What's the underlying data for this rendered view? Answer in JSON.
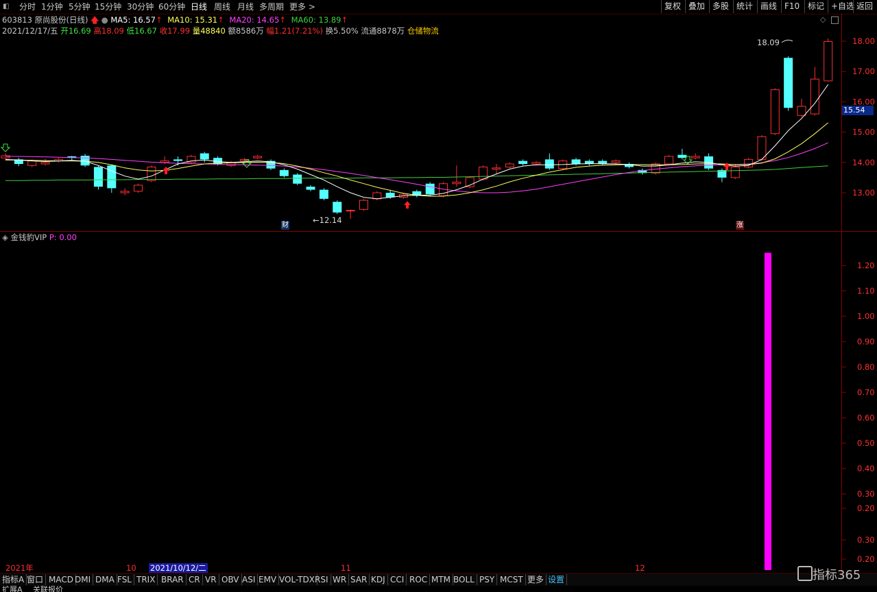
{
  "toolbar": {
    "periods": [
      "分时",
      "1分钟",
      "5分钟",
      "15分钟",
      "30分钟",
      "60分钟",
      "日线",
      "周线",
      "月线",
      "多周期",
      "更多 >"
    ],
    "active_period": "日线",
    "right_buttons": [
      "复权",
      "叠加",
      "多股",
      "统计",
      "画线",
      "F10",
      "标记",
      "+自选",
      "返回"
    ]
  },
  "quote": {
    "stock": "603813 原尚股份(日线)",
    "ma5": "MA5: 16.57",
    "ma10": "MA10: 15.31",
    "ma20": "MA20: 14.65",
    "ma60": "MA60: 13.89",
    "date": "2021/12/17/五",
    "open_label": "开",
    "open": "16.69",
    "high_label": "高",
    "high": "18.09",
    "low_label": "低",
    "low": "16.67",
    "close_label": "收",
    "close": "17.99",
    "vol_label": "量",
    "vol": "48840",
    "amt_label": "额",
    "amt": "8586万",
    "chg_label": "幅",
    "chg": "1.21(7.21%)",
    "turnover": "换5.50%",
    "float": "流通8878万",
    "sector": "仓储物流"
  },
  "annotations": {
    "high_mark": "18.09",
    "low_mark": "←12.14",
    "cai_badge": "财",
    "zhang_badge": "涨",
    "current_price": "15.54"
  },
  "indicator": {
    "name": "金钱豹VIP",
    "value": "P: 0.00"
  },
  "x_labels": {
    "year": "2021年",
    "oct": "10",
    "cursor_date": "2021/10/12/二",
    "nov": "11",
    "dec": "12"
  },
  "bottom_tabs": [
    "指标A",
    "窗口",
    "MACD",
    "DMI",
    "DMA",
    "FSL",
    "TRIX",
    "BRAR",
    "CR",
    "VR",
    "OBV",
    "ASI",
    "EMV",
    "VOL-TDX",
    "RSI",
    "WR",
    "SAR",
    "KDJ",
    "CCI",
    "ROC",
    "MTM",
    "BOLL",
    "PSY",
    "MCST",
    "更多",
    "设置"
  ],
  "status_tabs": [
    "扩展A",
    "关联报价"
  ],
  "logo": "指标365",
  "colors": {
    "up": "#ff3030",
    "down": "#54ffff",
    "ma5": "#ffffff",
    "ma10": "#ffff60",
    "ma20": "#ff40ff",
    "ma60": "#40d040",
    "indicator_bar": "#ff00ff",
    "frame": "#8a0000"
  },
  "chart_data": [
    {
      "type": "candlestick",
      "title": "603813 原尚股份(日线)",
      "y_ticks": [
        13.0,
        14.0,
        15.0,
        16.0,
        17.0,
        18.0
      ],
      "ylim": [
        12.0,
        18.3
      ],
      "x_labels": [
        "2021年",
        "10",
        "11",
        "12"
      ],
      "candles": [
        {
          "o": 14.15,
          "c": 14.22,
          "h": 14.3,
          "l": 14.1
        },
        {
          "o": 14.1,
          "c": 13.95,
          "h": 14.15,
          "l": 13.88
        },
        {
          "o": 13.9,
          "c": 14.05,
          "h": 14.1,
          "l": 13.85
        },
        {
          "o": 13.95,
          "c": 14.0,
          "h": 14.12,
          "l": 13.9
        },
        {
          "o": 14.05,
          "c": 14.1,
          "h": 14.15,
          "l": 14.0
        },
        {
          "o": 14.2,
          "c": 14.15,
          "h": 14.22,
          "l": 14.08
        },
        {
          "o": 14.22,
          "c": 13.9,
          "h": 14.28,
          "l": 13.85
        },
        {
          "o": 13.85,
          "c": 13.2,
          "h": 13.9,
          "l": 13.1
        },
        {
          "o": 13.9,
          "c": 13.15,
          "h": 13.92,
          "l": 13.0
        },
        {
          "o": 13.0,
          "c": 13.05,
          "h": 13.15,
          "l": 12.92
        },
        {
          "o": 13.05,
          "c": 13.25,
          "h": 13.3,
          "l": 13.0
        },
        {
          "o": 13.4,
          "c": 13.85,
          "h": 13.9,
          "l": 13.35
        },
        {
          "o": 14.0,
          "c": 14.05,
          "h": 14.2,
          "l": 13.95
        },
        {
          "o": 14.1,
          "c": 14.05,
          "h": 14.2,
          "l": 13.9
        },
        {
          "o": 14.0,
          "c": 14.2,
          "h": 14.25,
          "l": 13.95
        },
        {
          "o": 14.3,
          "c": 14.1,
          "h": 14.35,
          "l": 14.0
        },
        {
          "o": 14.15,
          "c": 13.95,
          "h": 14.2,
          "l": 13.9
        },
        {
          "o": 13.9,
          "c": 14.0,
          "h": 14.05,
          "l": 13.85
        },
        {
          "o": 14.05,
          "c": 14.1,
          "h": 14.15,
          "l": 14.0
        },
        {
          "o": 14.15,
          "c": 14.2,
          "h": 14.25,
          "l": 14.1
        },
        {
          "o": 14.05,
          "c": 13.8,
          "h": 14.1,
          "l": 13.75
        },
        {
          "o": 13.75,
          "c": 13.55,
          "h": 13.8,
          "l": 13.5
        },
        {
          "o": 13.6,
          "c": 13.3,
          "h": 13.65,
          "l": 13.25
        },
        {
          "o": 13.2,
          "c": 13.1,
          "h": 13.25,
          "l": 13.05
        },
        {
          "o": 13.1,
          "c": 12.8,
          "h": 13.15,
          "l": 12.75
        },
        {
          "o": 12.7,
          "c": 12.35,
          "h": 12.75,
          "l": 12.3
        },
        {
          "o": 12.4,
          "c": 12.42,
          "h": 12.45,
          "l": 12.14
        },
        {
          "o": 12.45,
          "c": 12.75,
          "h": 12.8,
          "l": 12.4
        },
        {
          "o": 12.8,
          "c": 13.0,
          "h": 13.05,
          "l": 12.75
        },
        {
          "o": 13.0,
          "c": 12.85,
          "h": 13.1,
          "l": 12.8
        },
        {
          "o": 12.85,
          "c": 12.95,
          "h": 13.0,
          "l": 12.8
        },
        {
          "o": 13.05,
          "c": 12.9,
          "h": 13.1,
          "l": 12.85
        },
        {
          "o": 13.3,
          "c": 12.95,
          "h": 13.35,
          "l": 12.9
        },
        {
          "o": 12.9,
          "c": 13.3,
          "h": 13.35,
          "l": 12.85
        },
        {
          "o": 13.3,
          "c": 13.35,
          "h": 13.9,
          "l": 13.2
        },
        {
          "o": 13.2,
          "c": 13.5,
          "h": 13.55,
          "l": 13.15
        },
        {
          "o": 13.45,
          "c": 13.85,
          "h": 13.9,
          "l": 13.4
        },
        {
          "o": 13.78,
          "c": 13.82,
          "h": 13.95,
          "l": 13.6
        },
        {
          "o": 13.85,
          "c": 13.95,
          "h": 14.0,
          "l": 13.8
        },
        {
          "o": 14.05,
          "c": 13.95,
          "h": 14.1,
          "l": 13.9
        },
        {
          "o": 13.95,
          "c": 14.0,
          "h": 14.05,
          "l": 13.9
        },
        {
          "o": 14.1,
          "c": 13.8,
          "h": 14.3,
          "l": 13.75
        },
        {
          "o": 13.8,
          "c": 14.05,
          "h": 14.1,
          "l": 13.75
        },
        {
          "o": 14.1,
          "c": 13.95,
          "h": 14.15,
          "l": 13.9
        },
        {
          "o": 14.05,
          "c": 13.95,
          "h": 14.1,
          "l": 13.9
        },
        {
          "o": 14.05,
          "c": 13.95,
          "h": 14.1,
          "l": 13.9
        },
        {
          "o": 14.0,
          "c": 14.05,
          "h": 14.1,
          "l": 13.95
        },
        {
          "o": 13.95,
          "c": 13.85,
          "h": 14.0,
          "l": 13.8
        },
        {
          "o": 13.75,
          "c": 13.65,
          "h": 13.8,
          "l": 13.6
        },
        {
          "o": 13.65,
          "c": 13.95,
          "h": 14.0,
          "l": 13.6
        },
        {
          "o": 13.95,
          "c": 14.2,
          "h": 14.25,
          "l": 13.9
        },
        {
          "o": 14.25,
          "c": 14.15,
          "h": 14.45,
          "l": 14.1
        },
        {
          "o": 14.15,
          "c": 14.2,
          "h": 14.3,
          "l": 14.1
        },
        {
          "o": 14.2,
          "c": 13.8,
          "h": 14.3,
          "l": 13.75
        },
        {
          "o": 13.75,
          "c": 13.5,
          "h": 13.8,
          "l": 13.35
        },
        {
          "o": 13.5,
          "c": 13.85,
          "h": 13.95,
          "l": 13.45
        },
        {
          "o": 13.85,
          "c": 14.1,
          "h": 14.15,
          "l": 13.8
        },
        {
          "o": 14.1,
          "c": 14.85,
          "h": 14.9,
          "l": 14.05
        },
        {
          "o": 14.95,
          "c": 16.4,
          "h": 16.45,
          "l": 14.9
        },
        {
          "o": 17.45,
          "c": 15.8,
          "h": 17.5,
          "l": 15.7
        },
        {
          "o": 15.55,
          "c": 15.85,
          "h": 16.1,
          "l": 15.5
        },
        {
          "o": 15.6,
          "c": 16.75,
          "h": 17.15,
          "l": 15.55
        },
        {
          "o": 16.69,
          "c": 17.99,
          "h": 18.09,
          "l": 16.67
        }
      ],
      "ma5": [
        14.1,
        14.08,
        14.05,
        14.03,
        14.05,
        14.07,
        14.04,
        13.9,
        13.72,
        13.55,
        13.45,
        13.55,
        13.75,
        13.95,
        14.05,
        14.08,
        14.03,
        14.0,
        14.02,
        14.05,
        14.02,
        13.92,
        13.78,
        13.6,
        13.42,
        13.2,
        13.0,
        12.85,
        12.8,
        12.85,
        12.9,
        12.92,
        12.92,
        12.98,
        13.1,
        13.25,
        13.45,
        13.62,
        13.78,
        13.88,
        13.92,
        13.92,
        13.93,
        13.95,
        13.96,
        13.96,
        13.95,
        13.93,
        13.88,
        13.88,
        13.92,
        13.98,
        14.02,
        14.0,
        13.92,
        13.88,
        13.9,
        14.1,
        14.55,
        15.05,
        15.45,
        15.95,
        16.57
      ],
      "ma10": [
        14.08,
        14.08,
        14.07,
        14.06,
        14.05,
        14.05,
        14.04,
        14.0,
        13.92,
        13.82,
        13.75,
        13.72,
        13.74,
        13.8,
        13.88,
        13.95,
        13.98,
        13.99,
        14.0,
        14.01,
        14.0,
        13.96,
        13.88,
        13.78,
        13.66,
        13.55,
        13.42,
        13.3,
        13.18,
        13.08,
        12.98,
        12.92,
        12.88,
        12.89,
        12.93,
        13.0,
        13.1,
        13.22,
        13.36,
        13.48,
        13.58,
        13.68,
        13.76,
        13.84,
        13.88,
        13.91,
        13.92,
        13.93,
        13.93,
        13.92,
        13.92,
        13.93,
        13.95,
        13.96,
        13.95,
        13.93,
        13.93,
        13.98,
        14.12,
        14.35,
        14.62,
        14.95,
        15.31
      ],
      "ma20": [
        14.2,
        14.2,
        14.19,
        14.18,
        14.17,
        14.16,
        14.15,
        14.13,
        14.1,
        14.07,
        14.04,
        14.01,
        13.99,
        13.97,
        13.96,
        13.95,
        13.94,
        13.93,
        13.92,
        13.91,
        13.9,
        13.88,
        13.85,
        13.81,
        13.76,
        13.7,
        13.64,
        13.57,
        13.5,
        13.43,
        13.36,
        13.28,
        13.2,
        13.12,
        13.06,
        13.02,
        13.0,
        13.0,
        13.02,
        13.06,
        13.12,
        13.2,
        13.28,
        13.36,
        13.44,
        13.52,
        13.6,
        13.67,
        13.73,
        13.78,
        13.82,
        13.86,
        13.89,
        13.91,
        13.92,
        13.93,
        13.95,
        13.99,
        14.06,
        14.16,
        14.3,
        14.46,
        14.65
      ],
      "ma60": [
        13.4,
        13.4,
        13.41,
        13.41,
        13.42,
        13.42,
        13.42,
        13.43,
        13.43,
        13.43,
        13.44,
        13.44,
        13.44,
        13.45,
        13.45,
        13.45,
        13.46,
        13.46,
        13.46,
        13.47,
        13.47,
        13.47,
        13.48,
        13.48,
        13.48,
        13.48,
        13.48,
        13.49,
        13.49,
        13.49,
        13.5,
        13.5,
        13.51,
        13.51,
        13.52,
        13.53,
        13.54,
        13.55,
        13.56,
        13.57,
        13.58,
        13.59,
        13.6,
        13.61,
        13.62,
        13.63,
        13.64,
        13.65,
        13.66,
        13.67,
        13.68,
        13.69,
        13.7,
        13.71,
        13.72,
        13.73,
        13.74,
        13.75,
        13.77,
        13.8,
        13.83,
        13.86,
        13.89
      ]
    },
    {
      "type": "bar",
      "title": "金钱豹VIP",
      "y_ticks": [
        0.2,
        0.3,
        0.4,
        0.5,
        0.6,
        0.7,
        0.8,
        0.9,
        1.0,
        1.1,
        1.2
      ],
      "extra_ticks": [
        "0.30",
        "0.20",
        "0.30"
      ],
      "ylim": [
        0.0,
        1.3
      ],
      "bar_index": 57,
      "bar_value": 1.25
    }
  ]
}
